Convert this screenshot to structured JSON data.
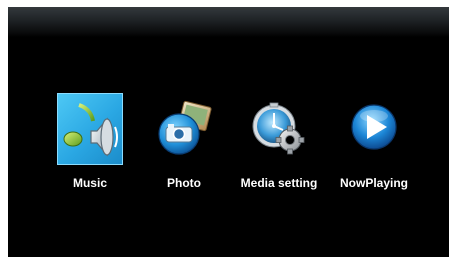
{
  "menu": {
    "items": [
      {
        "label": "Music",
        "icon": "music-icon",
        "selected": true
      },
      {
        "label": "Photo",
        "icon": "photo-icon",
        "selected": false
      },
      {
        "label": "Media setting",
        "icon": "media-settings-icon",
        "selected": false
      },
      {
        "label": "NowPlaying",
        "icon": "play-icon",
        "selected": false
      }
    ]
  },
  "colors": {
    "background": "#000000",
    "selection": "#2aa7e3",
    "label": "#ffffff"
  }
}
